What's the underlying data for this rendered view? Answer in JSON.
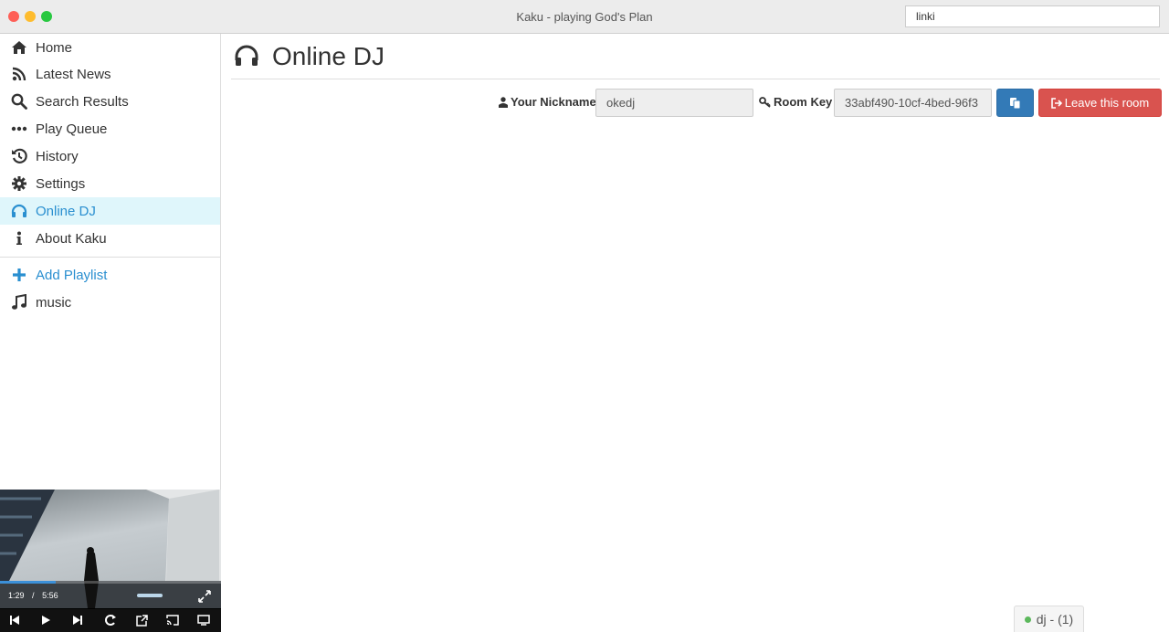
{
  "window": {
    "title": "Kaku - playing God's Plan"
  },
  "search": {
    "value": "linki"
  },
  "sidebar": {
    "items": [
      {
        "label": "Home",
        "icon": "home-icon"
      },
      {
        "label": "Latest News",
        "icon": "rss-icon"
      },
      {
        "label": "Search Results",
        "icon": "search-icon"
      },
      {
        "label": "Play Queue",
        "icon": "ellipsis-icon"
      },
      {
        "label": "History",
        "icon": "history-icon"
      },
      {
        "label": "Settings",
        "icon": "gear-icon"
      },
      {
        "label": "Online DJ",
        "icon": "headphones-icon",
        "active": true
      },
      {
        "label": "About Kaku",
        "icon": "info-icon"
      }
    ],
    "add_playlist": "Add Playlist",
    "playlists": [
      {
        "label": "music",
        "icon": "music-note-icon"
      }
    ]
  },
  "player": {
    "current_time": "1:29",
    "separator": "/",
    "duration": "5:56",
    "progress": 0.25,
    "volume": 0.8
  },
  "main": {
    "title": "Online DJ",
    "nickname_label": "Your Nickname",
    "nickname_value": "okedj",
    "room_key_label": "Room Key",
    "room_key_value": "33abf490-10cf-4bed-96f3",
    "leave_label": "Leave this room"
  },
  "status": {
    "dj_label": "dj - (1)"
  },
  "colors": {
    "accent": "#2a8fd0",
    "active_bg": "#dff6fb",
    "primary": "#337ab7",
    "danger": "#d9534f",
    "online": "#5cb85c"
  }
}
